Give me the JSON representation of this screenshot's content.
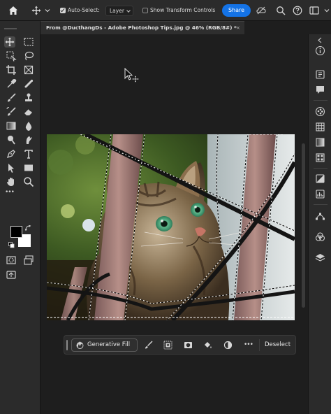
{
  "options_bar": {
    "auto_select_label": "Auto-Select:",
    "auto_select_checked": true,
    "layer_dropdown_value": "Layer",
    "show_transform_label": "Show Transform Controls",
    "show_transform_checked": false,
    "share_label": "Share"
  },
  "document_tab": {
    "title": "From @DucthangDs - Adobe Photoshop Tips.jpg @ 46% (RGB/8#) *",
    "close_glyph": "×"
  },
  "colors": {
    "accent": "#1473e6",
    "foreground_swatch": "#000000",
    "background_swatch": "#ffffff"
  },
  "contextual_taskbar": {
    "generative_fill_label": "Generative Fill",
    "more_glyph": "•••",
    "deselect_label": "Deselect"
  },
  "toolbar_more_glyph": "•••"
}
